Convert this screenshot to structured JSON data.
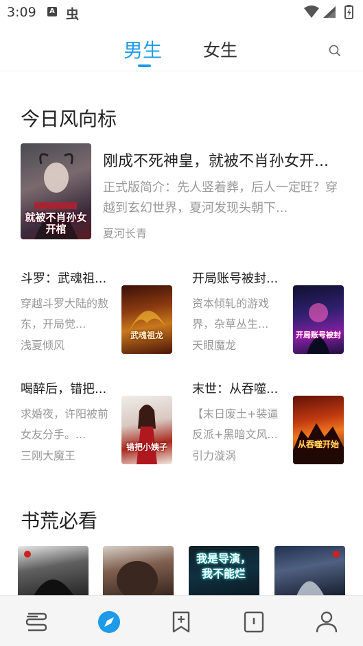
{
  "status": {
    "time": "3:09",
    "a_badge": "A",
    "bug_glyph": "虫"
  },
  "tabs": {
    "male": "男生",
    "female": "女生"
  },
  "sections": {
    "today": "今日风向标",
    "must_read": "书荒必看"
  },
  "featured": {
    "title": "刚成不死神皇，就被不肖孙女开...",
    "desc": "正式版简介：先人竖着葬，后人一定旺？穿越到玄幻世界，夏河发现头朝下...",
    "author": "夏河长青",
    "cover_text": "就被不肖孙女开棺"
  },
  "books": [
    {
      "title": "斗罗：武魂祖...",
      "desc": "穿越斗罗大陆的敖东，开局觉...",
      "author": "浅夏倾风",
      "cover_text": "武魂祖龙"
    },
    {
      "title": "开局账号被封...",
      "desc": "资本倾轧的游戏界，杂草丛生...",
      "author": "天眼魔龙",
      "cover_text": "开局账号被封"
    },
    {
      "title": "喝醉后，错把...",
      "desc": "求婚夜，许阳被前女友分手。...",
      "author": "三刚大魔王",
      "cover_text": "错把小姨子"
    },
    {
      "title": "末世：从吞噬...",
      "desc": "【末日废土+装逼反派+黑暗文风...",
      "author": "引力漩涡",
      "cover_text": "从吞噬开始"
    }
  ],
  "row_covers": [
    {
      "text": ""
    },
    {
      "text": ""
    },
    {
      "text": "我是导演，我不能烂"
    },
    {
      "text": ""
    }
  ],
  "colors": {
    "accent": "#1e9be8",
    "text": "#222222",
    "muted": "#999999",
    "nav_bg": "#f5f5f5"
  },
  "nav": {
    "icons": [
      "bookshelf-icon",
      "discover-icon",
      "bookmark-add-icon",
      "category-icon",
      "profile-icon"
    ],
    "active": "discover-icon"
  }
}
